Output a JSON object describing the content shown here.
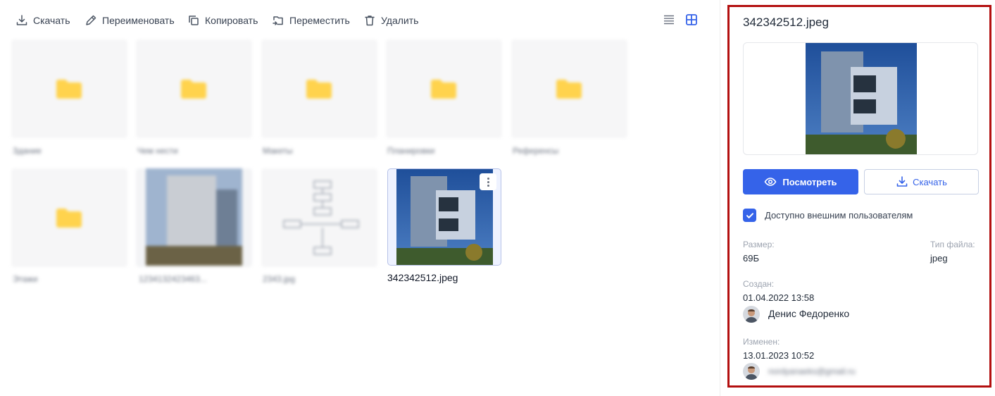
{
  "toolbar": {
    "download": "Скачать",
    "rename": "Переименовать",
    "copy": "Копировать",
    "move": "Переместить",
    "delete": "Удалить"
  },
  "grid": {
    "tiles": [
      {
        "name": "Здание",
        "type": "folder"
      },
      {
        "name": "Чем нести",
        "type": "folder"
      },
      {
        "name": "Макеты",
        "type": "folder"
      },
      {
        "name": "Планировки",
        "type": "folder"
      },
      {
        "name": "Референсы",
        "type": "folder"
      },
      {
        "name": "Этажи",
        "type": "folder"
      },
      {
        "name": "1234132423463...",
        "type": "image"
      },
      {
        "name": "2343.jpg",
        "type": "diagram"
      }
    ],
    "selected": {
      "name": "342342512.jpeg"
    }
  },
  "panel": {
    "title": "342342512.jpeg",
    "view_button": "Посмотреть",
    "download_button": "Скачать",
    "external_access_label": "Доступно внешним пользователям",
    "external_access_checked": true,
    "size_label": "Размер:",
    "size_value": "69Б",
    "type_label": "Тип файла:",
    "type_value": "jpeg",
    "created_label": "Создан:",
    "created_value": "01.04.2022 13:58",
    "created_by": "Денис Федоренко",
    "modified_label": "Изменен:",
    "modified_value": "13.01.2023 10:52",
    "modified_by": "nordyanaeks@gmail.ru"
  },
  "colors": {
    "accent": "#3563e9",
    "highlight_border": "#b30f0f",
    "folder": "#ffd34d"
  }
}
